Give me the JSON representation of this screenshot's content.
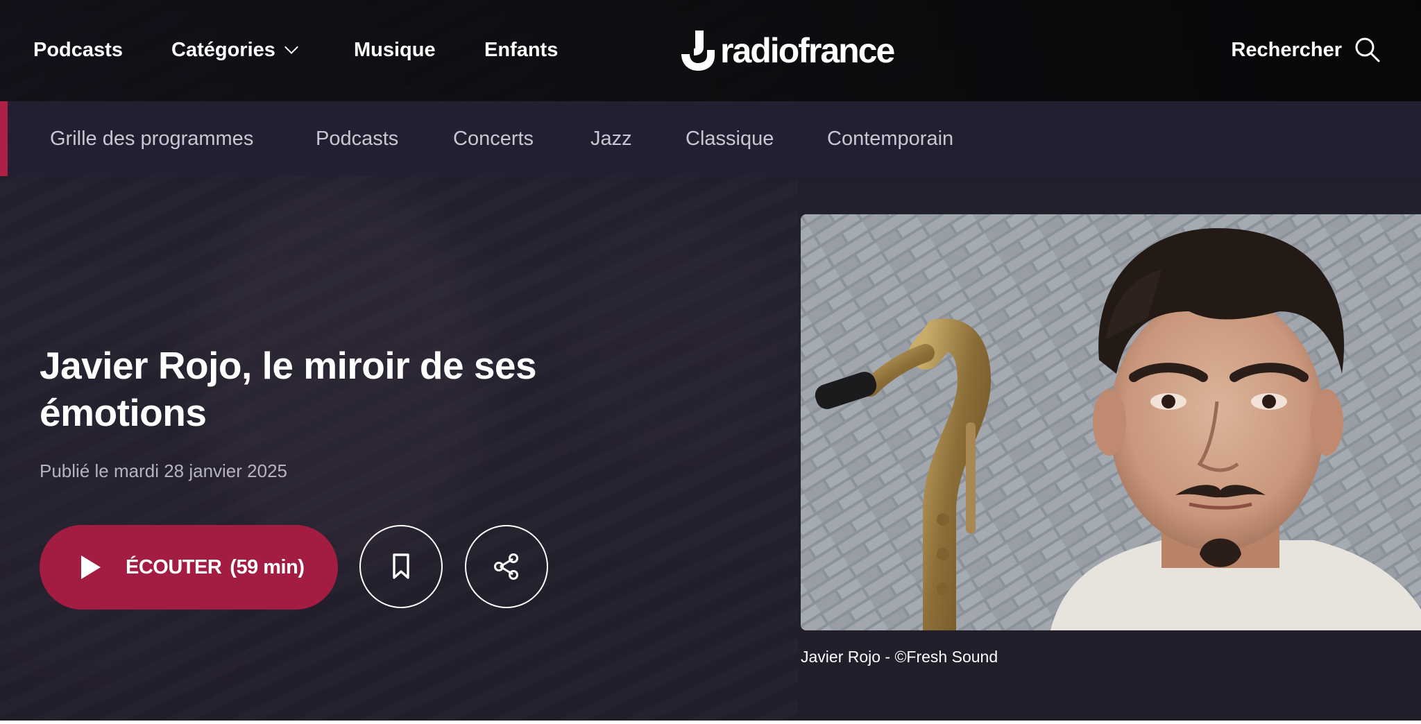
{
  "header": {
    "nav": [
      {
        "label": "Podcasts"
      },
      {
        "label": "Catégories"
      },
      {
        "label": "Musique"
      },
      {
        "label": "Enfants"
      }
    ],
    "logo_text": "radiofrance",
    "search_label": "Rechercher"
  },
  "sub_nav": {
    "items": [
      {
        "label": "Grille des programmes"
      },
      {
        "label": "Podcasts"
      },
      {
        "label": "Concerts"
      },
      {
        "label": "Jazz"
      },
      {
        "label": "Classique"
      },
      {
        "label": "Contemporain"
      }
    ],
    "accent_color": "#b01f45"
  },
  "hero": {
    "title": "Javier Rojo, le miroir de ses émotions",
    "published": "Publié le mardi 28 janvier 2025",
    "listen_label": "ÉCOUTER",
    "duration": "(59 min)",
    "button_color": "#a31d42",
    "image_caption": "Javier Rojo - ©Fresh Sound"
  },
  "icons": {
    "search": "search-icon",
    "play": "play-icon",
    "bookmark": "bookmark-icon",
    "share": "share-icon",
    "chevron": "chevron-down-icon"
  }
}
